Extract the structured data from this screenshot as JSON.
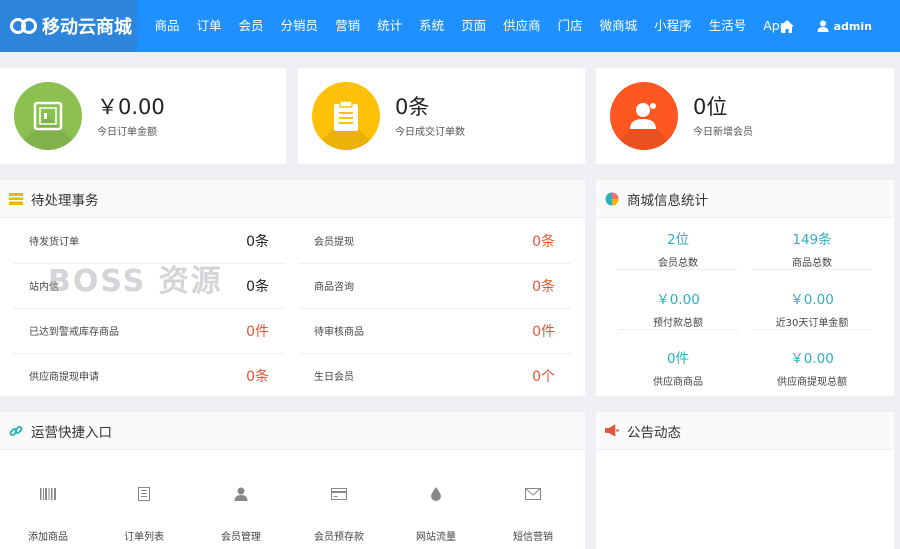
{
  "header": {
    "logo": "移动云商城",
    "nav": [
      "商品",
      "订单",
      "会员",
      "分销员",
      "营销",
      "统计",
      "系统",
      "页面",
      "供应商",
      "门店",
      "微商城",
      "小程序",
      "生活号",
      "App"
    ],
    "user": "admin"
  },
  "stats": [
    {
      "value": "￥0.00",
      "label": "今日订单金额",
      "color": "#8cc152"
    },
    {
      "value": "0条",
      "label": "今日成交订单数",
      "color": "#ffc107"
    },
    {
      "value": "0位",
      "label": "今日新增会员",
      "color": "#ff5722"
    }
  ],
  "pending": {
    "title": "待处理事务",
    "rows": [
      [
        {
          "label": "待发货订单",
          "value": "0条",
          "color": "black"
        },
        {
          "label": "会员提现",
          "value": "0条",
          "color": "red"
        }
      ],
      [
        {
          "label": "站内信",
          "value": "0条",
          "color": "black"
        },
        {
          "label": "商品咨询",
          "value": "0条",
          "color": "red"
        }
      ],
      [
        {
          "label": "已达到警戒库存商品",
          "value": "0件",
          "color": "red"
        },
        {
          "label": "待审核商品",
          "value": "0件",
          "color": "red"
        }
      ],
      [
        {
          "label": "供应商提现申请",
          "value": "0条",
          "color": "red"
        },
        {
          "label": "生日会员",
          "value": "0个",
          "color": "red"
        }
      ]
    ]
  },
  "shop_stats": {
    "title": "商城信息统计",
    "items": [
      {
        "value": "2位",
        "label": "会员总数"
      },
      {
        "value": "149条",
        "label": "商品总数"
      },
      {
        "value": "￥0.00",
        "label": "预付款总额"
      },
      {
        "value": "￥0.00",
        "label": "近30天订单金额"
      },
      {
        "value": "0件",
        "label": "供应商商品"
      },
      {
        "value": "￥0.00",
        "label": "供应商提现总额"
      }
    ]
  },
  "quick": {
    "title": "运营快捷入口",
    "items": [
      {
        "label": "添加商品",
        "icon": "barcode-icon"
      },
      {
        "label": "订单列表",
        "icon": "list-icon"
      },
      {
        "label": "会员管理",
        "icon": "user-icon"
      },
      {
        "label": "会员预存款",
        "icon": "card-icon"
      },
      {
        "label": "网站流量",
        "icon": "drop-icon"
      },
      {
        "label": "短信营销",
        "icon": "envelope-icon"
      }
    ]
  },
  "announce": {
    "title": "公告动态"
  },
  "watermark": "BOSS 资源"
}
